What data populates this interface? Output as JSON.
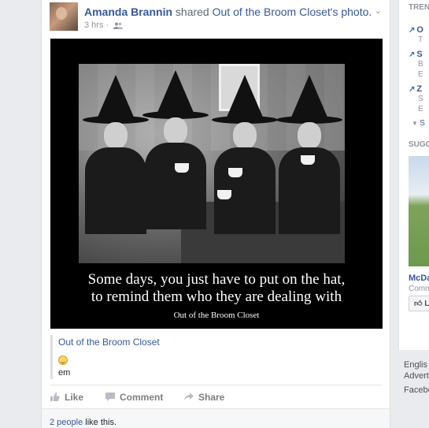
{
  "post": {
    "author": "Amanda Brannin",
    "action": "shared",
    "source_page": "Out of the Broom Closet",
    "source_suffix": "'s photo.",
    "time": "3 hrs",
    "visibility_icon": "people-icon",
    "menu_icon": "chevron-down-icon"
  },
  "photo": {
    "caption_line1": "Some days, you just have to put on the hat,",
    "caption_line2": "to remind them who they are dealing with",
    "credit": "Out of the Broom Closet"
  },
  "attached": {
    "source": "Out of the Broom Closet",
    "emoji_icon": "smiley-icon",
    "text": "em"
  },
  "actions": {
    "like": "Like",
    "comment": "Comment",
    "share": "Share"
  },
  "likes": {
    "count": "2 people",
    "text": " like this."
  },
  "sidebar": {
    "trending_title": "TREN",
    "trends": [
      {
        "title": "O",
        "sub": [
          "T"
        ]
      },
      {
        "title": "S",
        "sub": [
          "B",
          "E"
        ]
      },
      {
        "title": "Z",
        "sub": [
          "S",
          "E"
        ]
      }
    ],
    "see_more": "S",
    "suggested_title": "SUGG",
    "suggested_name": "McDa",
    "suggested_sub": "Comm",
    "like_button": "L"
  },
  "footer": {
    "language": "Englis",
    "advertising": "Advert",
    "facebook": "Facebo"
  },
  "colors": {
    "link": "#365899",
    "background": "#e9ebee"
  }
}
